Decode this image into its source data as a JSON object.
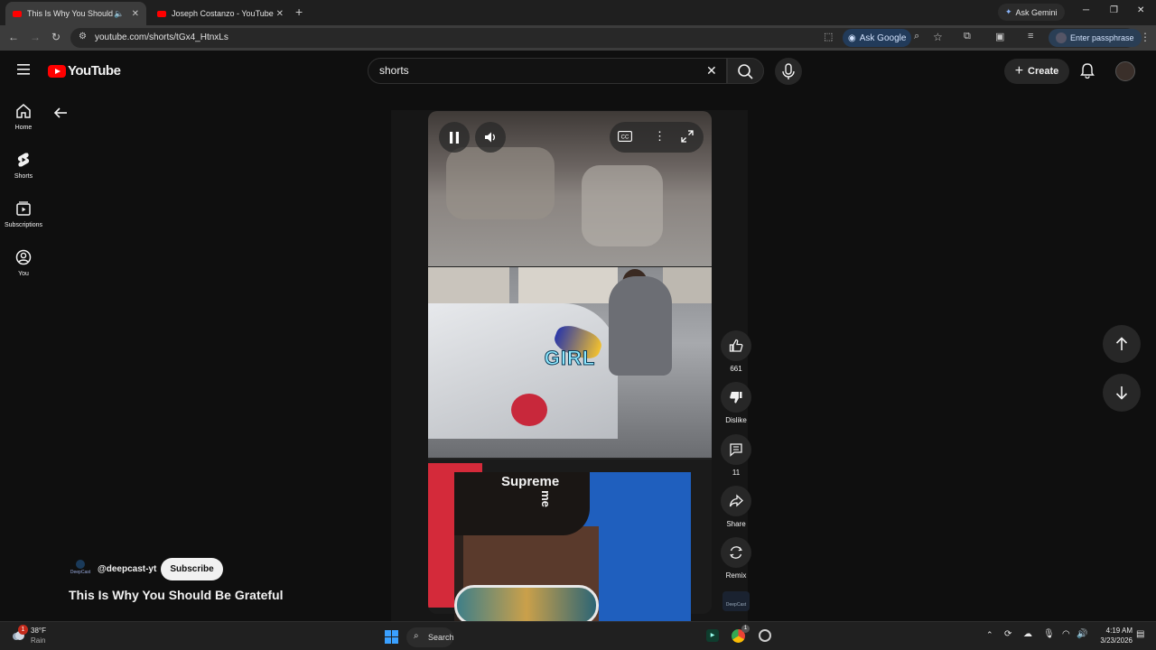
{
  "browser": {
    "tabs": [
      {
        "title": "This Is Why You Should Be",
        "active": true
      },
      {
        "title": "Joseph Costanzo - YouTube",
        "active": false
      }
    ],
    "new_tab": "+",
    "ask_gemini": "Ask Gemini",
    "url": "youtube.com/shorts/tGx4_HtnxLs",
    "ask_google": "Ask Google",
    "passphrase": "Enter passphrase"
  },
  "youtube": {
    "logo": "YouTube",
    "search_value": "shorts",
    "create_label": "Create",
    "nav": [
      {
        "label": "Home",
        "icon": "home-icon"
      },
      {
        "label": "Shorts",
        "icon": "shorts-icon"
      },
      {
        "label": "Subscriptions",
        "icon": "subscriptions-icon"
      },
      {
        "label": "You",
        "icon": "you-icon"
      }
    ]
  },
  "video": {
    "caption": "GIRL",
    "hat_text": "Supreme",
    "hat_text_2": "me"
  },
  "actions": {
    "likes": "661",
    "dislike": "Dislike",
    "comments": "11",
    "share": "Share",
    "remix": "Remix",
    "channel_badge": "DeepCast"
  },
  "channel": {
    "badge": "DeepCast",
    "handle": "@deepcast-yt",
    "subscribe": "Subscribe",
    "title": "This Is Why You Should Be Grateful"
  },
  "taskbar": {
    "weather_temp": "38°F",
    "weather_desc": "Rain",
    "weather_badge": "1",
    "search": "Search",
    "chrome_badge": "1",
    "time": "4:19 AM",
    "date": "3/23/2026"
  },
  "colors": {
    "youtube_red": "#ff0000",
    "background": "#0f0f0f",
    "caption": "#8ee8ff"
  }
}
